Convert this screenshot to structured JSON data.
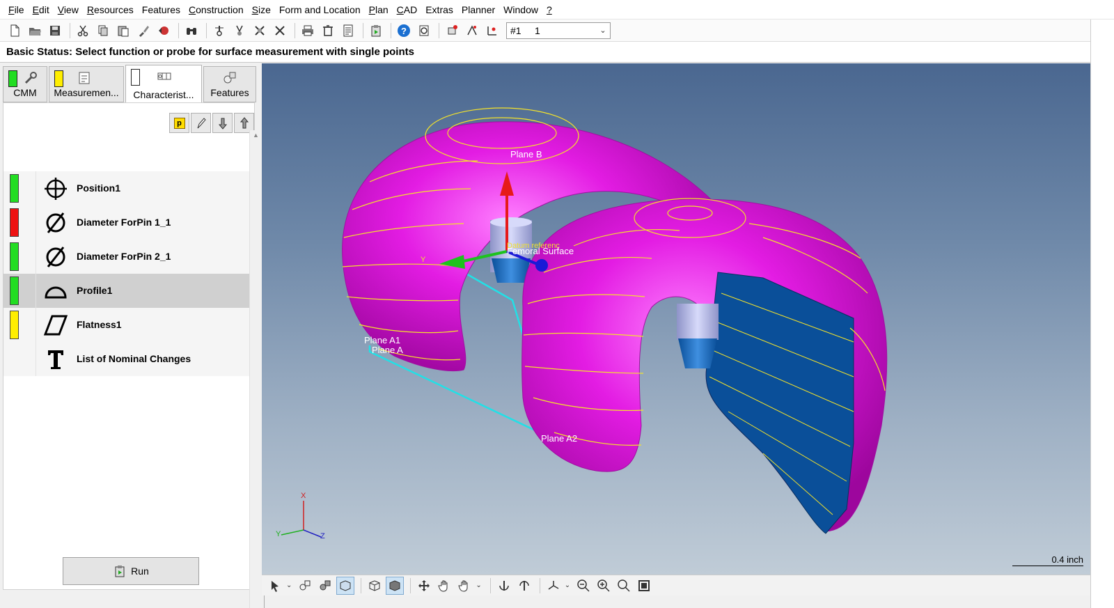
{
  "menu": [
    {
      "label": "File",
      "u": "F",
      "rest": "ile"
    },
    {
      "label": "Edit",
      "u": "E",
      "rest": "dit"
    },
    {
      "label": "View",
      "u": "V",
      "rest": "iew"
    },
    {
      "label": "Resources",
      "u": "R",
      "rest": "esources"
    },
    {
      "label": "Features",
      "u": "",
      "rest": "Features"
    },
    {
      "label": "Construction",
      "u": "C",
      "rest": "onstruction"
    },
    {
      "label": "Size",
      "u": "S",
      "rest": "ize"
    },
    {
      "label": "Form and Location",
      "u": "",
      "rest": "Form and Location"
    },
    {
      "label": "Plan",
      "u": "P",
      "rest": "lan"
    },
    {
      "label": "CAD",
      "u": "C",
      "rest": "AD"
    },
    {
      "label": "Extras",
      "u": "",
      "rest": "Extras"
    },
    {
      "label": "Planner",
      "u": "",
      "rest": "Planner"
    },
    {
      "label": "Window",
      "u": "",
      "rest": "Window"
    },
    {
      "label": "?",
      "u": "?",
      "rest": ""
    }
  ],
  "toolbar": {
    "select_a": "#1",
    "select_b": "1"
  },
  "status": {
    "text": "Basic Status: Select function or probe for surface measurement with single points"
  },
  "tabs": [
    {
      "label": "CMM",
      "color": "#22dd22"
    },
    {
      "label": "Measuremen...",
      "color": "#ffee00"
    },
    {
      "label": "Characterist...",
      "color": "#ffffff"
    },
    {
      "label": "Features",
      "color": ""
    }
  ],
  "list_tools": {
    "p_label": "p"
  },
  "characteristics": [
    {
      "label": "Position1",
      "status": "#22dd22",
      "icon": "position-icon"
    },
    {
      "label": "Diameter ForPin 1_1",
      "status": "#ee1111",
      "icon": "diameter-icon"
    },
    {
      "label": "Diameter ForPin 2_1",
      "status": "#22dd22",
      "icon": "diameter-icon"
    },
    {
      "label": "Profile1",
      "status": "#22dd22",
      "icon": "profile-icon"
    },
    {
      "label": "Flatness1",
      "status": "#ffee00",
      "icon": "flatness-icon"
    },
    {
      "label": "List of Nominal Changes",
      "status": "",
      "icon": "text-icon"
    }
  ],
  "run": {
    "label": "Run"
  },
  "viewport": {
    "labels": {
      "plane_b": "Plane B",
      "datum_ref": "Datum referenc",
      "femoral": "Femoral Surface",
      "plane_a1": "Plane A1",
      "plane_a": "Plane A",
      "plane_a2": "Plane A2",
      "axis_x": "X",
      "axis_y": "Y",
      "axis_z": "Z",
      "triad_y": "Y"
    },
    "scale": "0.4 inch",
    "colors": {
      "part": "#e619e6",
      "flat": "#0a4f99",
      "frame": "#22e0e6"
    }
  }
}
